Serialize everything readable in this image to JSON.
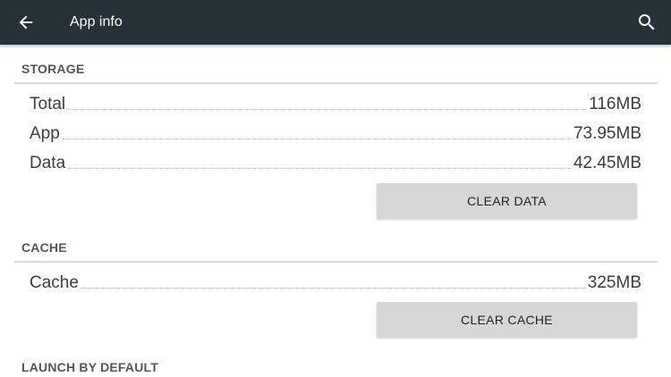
{
  "toolbar": {
    "title": "App info",
    "back_icon": "arrow-left-icon",
    "search_icon": "search-icon",
    "background": "#263238"
  },
  "storage": {
    "header": "STORAGE",
    "rows": [
      {
        "label": "Total",
        "value": "116MB"
      },
      {
        "label": "App",
        "value": "73.95MB"
      },
      {
        "label": "Data",
        "value": "42.45MB"
      }
    ],
    "clear_button": "CLEAR DATA"
  },
  "cache": {
    "header": "CACHE",
    "rows": [
      {
        "label": "Cache",
        "value": "325MB"
      }
    ],
    "clear_button": "CLEAR CACHE"
  },
  "launch_by_default": {
    "header": "LAUNCH BY DEFAULT"
  }
}
